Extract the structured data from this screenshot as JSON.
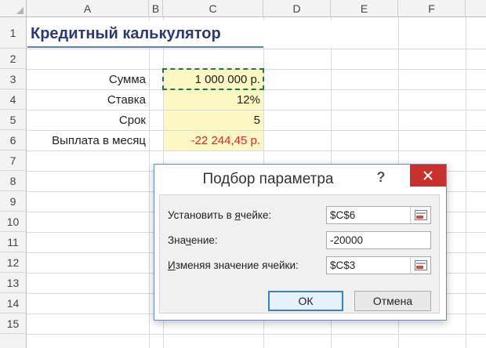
{
  "columns": [
    "A",
    "B",
    "C",
    "D",
    "E",
    "F"
  ],
  "rows": [
    "1",
    "2",
    "3",
    "4",
    "5",
    "6",
    "7",
    "8",
    "9",
    "10",
    "11",
    "12",
    "13",
    "14",
    "15"
  ],
  "sheet": {
    "title": "Кредитный калькулятор",
    "labels": {
      "sum": "Сумма",
      "rate": "Ставка",
      "term": "Срок",
      "payment": "Выплата в месяц"
    },
    "values": {
      "sum": "1 000 000 р.",
      "rate": "12%",
      "term": "5",
      "payment": "-22 244,45 р."
    }
  },
  "dialog": {
    "title": "Подбор параметра",
    "help": "?",
    "set_cell_label_pre": "Установить в ",
    "set_cell_label_ul": "я",
    "set_cell_label_post": "чейке:",
    "set_cell_value": "$C$6",
    "value_label_pre": "Зна",
    "value_label_ul": "ч",
    "value_label_post": "ение:",
    "value_value": "-20000",
    "change_label_pre": "",
    "change_label_ul": "И",
    "change_label_post": "зменяя значение ячейки:",
    "change_value": "$C$3",
    "ok_label": "ОК",
    "cancel_label": "Отмена"
  },
  "colors": {
    "title": "#2b3a70",
    "highlight": "#fdf7c2",
    "negative": "#e0242e",
    "close": "#c8312d"
  }
}
